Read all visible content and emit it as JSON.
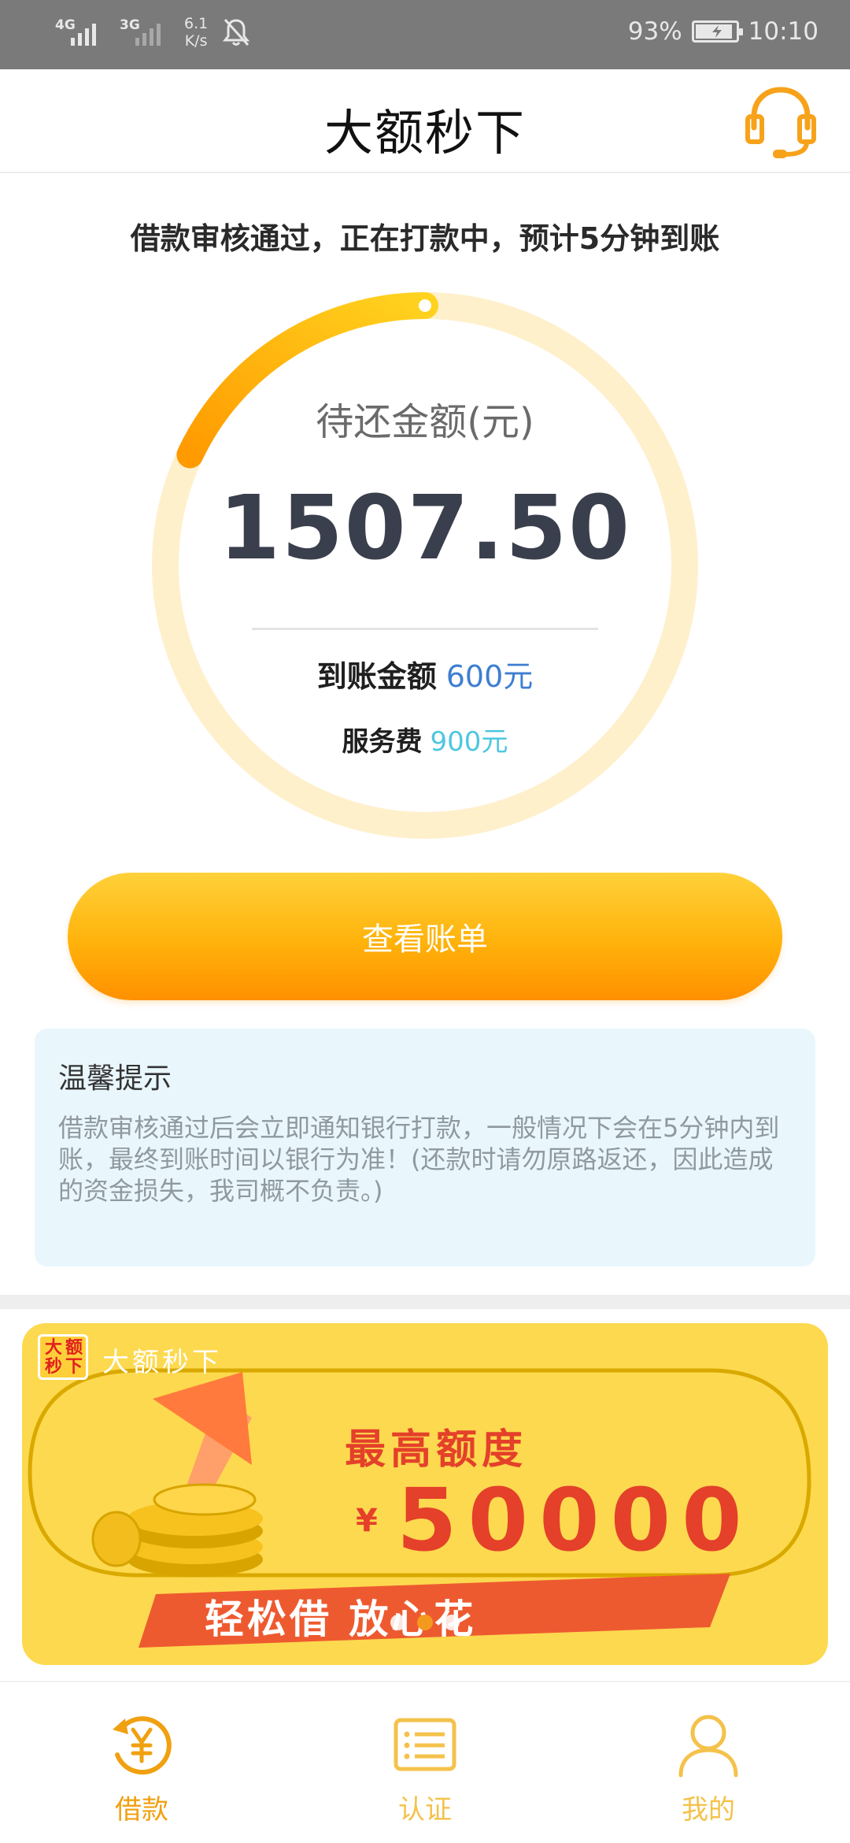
{
  "status_bar": {
    "network1": "4G",
    "network2": "3G",
    "speed_value": "6.1",
    "speed_unit": "K/s",
    "battery": "93%",
    "time": "10:10"
  },
  "header": {
    "title": "大额秒下",
    "customer_service_icon": "headset-icon"
  },
  "status_message": "借款审核通过，正在打款中，预计5分钟到账",
  "summary": {
    "label": "待还金额(元)",
    "amount": "1507.50",
    "progress_fraction": 0.18,
    "arrive_label": "到账金额",
    "arrive_value": "600元",
    "fee_label": "服务费",
    "fee_value": "900元"
  },
  "view_bill_button": "查看账单",
  "tips": {
    "title": "温馨提示",
    "body": "借款审核通过后会立即通知银行打款，一般情况下会在5分钟内到账，最终到账时间以银行为准！(还款时请勿原路返还，因此造成的资金损失，我司概不负责。)"
  },
  "banner": {
    "logo_text": [
      "大",
      "额",
      "秒",
      "下"
    ],
    "app_name": "大额秒下",
    "limit_title": "最高额度",
    "currency": "¥",
    "limit_amount": "50000",
    "slogan": "轻松借 放心花",
    "pages": 3,
    "active_page": 2
  },
  "tabs": [
    {
      "label": "借款",
      "icon": "yen-refresh-icon",
      "active": true
    },
    {
      "label": "认证",
      "icon": "list-card-icon",
      "active": false
    },
    {
      "label": "我的",
      "icon": "user-icon",
      "active": false
    }
  ],
  "colors": {
    "accent": "#FFA500",
    "arrive_value": "#3F7FD0",
    "fee_value": "#4DC7E0",
    "tips_bg": "#E9F7FD"
  }
}
